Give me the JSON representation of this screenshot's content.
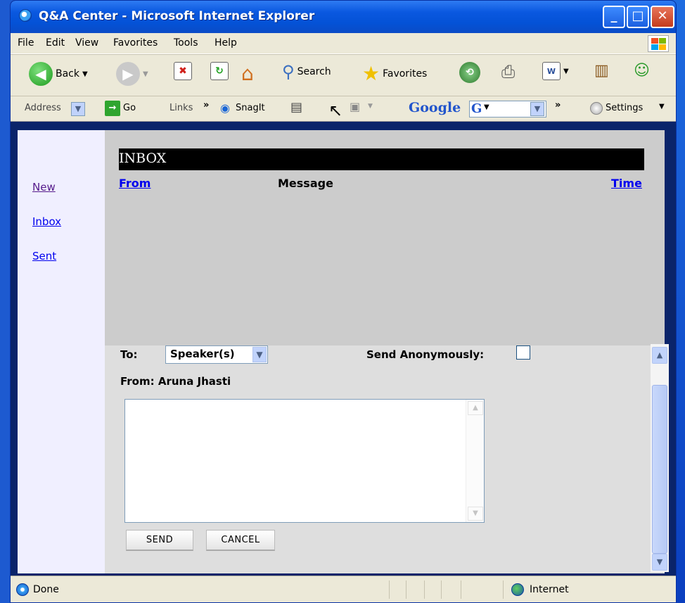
{
  "window": {
    "title": "Q&A Center - Microsoft Internet Explorer",
    "min": "_",
    "max": "□",
    "close": "✕"
  },
  "menu": [
    "File",
    "Edit",
    "View",
    "Favorites",
    "Tools",
    "Help"
  ],
  "toolbar": {
    "back": "Back",
    "search": "Search",
    "favorites": "Favorites"
  },
  "addressbar": {
    "address": "Address",
    "go": "Go",
    "links": "Links",
    "links_more": "»",
    "snagit": "SnagIt",
    "google": "Google",
    "google_g": "G",
    "more": "»",
    "settings": "Settings"
  },
  "nav": {
    "new": "New",
    "inbox": "Inbox",
    "sent": "Sent"
  },
  "inbox": {
    "header": "INBOX",
    "col_from": "From",
    "col_message": "Message",
    "col_time": "Time"
  },
  "compose": {
    "to_label": "To:",
    "to_value": "Speaker(s)",
    "anon_label": "Send Anonymously:",
    "from_label": "From: Aruna Jhasti",
    "send": "SEND",
    "cancel": "CANCEL"
  },
  "status": {
    "left": "Done",
    "zone": "Internet"
  },
  "colors": {
    "title_bar": "#0a58e0",
    "inbox_bar": "#000000",
    "link": "#0000ee"
  }
}
